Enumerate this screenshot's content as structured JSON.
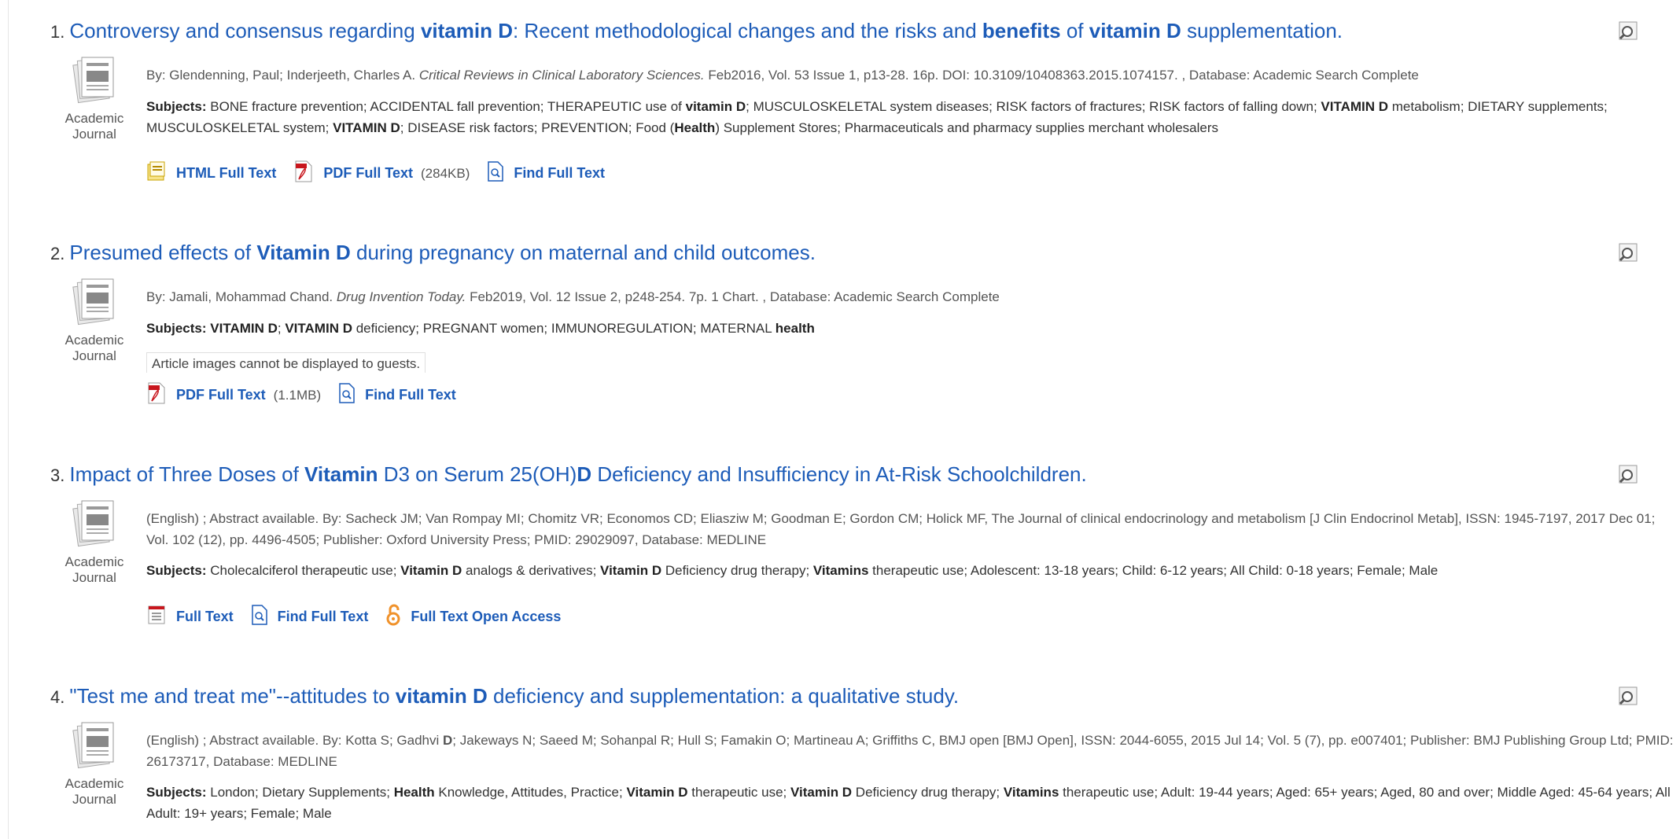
{
  "icons": {
    "document": "academic-journal-icon",
    "preview": "magnifier-preview-icon",
    "html": "html-document-icon",
    "pdf": "pdf-icon",
    "find": "find-document-icon",
    "open_access": "open-lock-icon",
    "fulltext": "fulltext-document-icon"
  },
  "colors": {
    "link": "#1d5cb8",
    "open_access": "#f0922b"
  },
  "results": [
    {
      "number": "1.",
      "title": [
        {
          "t": "Controversy and consensus regarding "
        },
        {
          "t": "vitamin D",
          "b": true
        },
        {
          "t": ": Recent methodological changes and the risks and "
        },
        {
          "t": "benefits",
          "b": true
        },
        {
          "t": " of "
        },
        {
          "t": "vitamin D",
          "b": true
        },
        {
          "t": " supplementation."
        }
      ],
      "type_line1": "Academic",
      "type_line2": "Journal",
      "meta": [
        {
          "t": "By: Glendenning, Paul; Inderjeeth, Charles A. "
        },
        {
          "t": "Critical Reviews in Clinical Laboratory Sciences.",
          "i": true
        },
        {
          "t": " Feb2016, Vol. 53 Issue 1, p13-28. 16p. DOI: 10.3109/10408363.2015.1074157. , Database: Academic Search Complete"
        }
      ],
      "subjects_label": "Subjects:",
      "subjects": [
        {
          "t": " BONE fracture prevention; ACCIDENTAL fall prevention; THERAPEUTIC use of "
        },
        {
          "t": "vitamin D",
          "b": true
        },
        {
          "t": "; MUSCULOSKELETAL system diseases; RISK factors of fractures; RISK factors of falling down; "
        },
        {
          "t": "VITAMIN D",
          "b": true
        },
        {
          "t": " metabolism; DIETARY supplements; MUSCULOSKELETAL system; "
        },
        {
          "t": "VITAMIN D",
          "b": true
        },
        {
          "t": "; DISEASE risk factors; PREVENTION; Food ("
        },
        {
          "t": "Health",
          "b": true
        },
        {
          "t": ") Supplement Stores; Pharmaceuticals and pharmacy supplies merchant wholesalers"
        }
      ],
      "links": [
        {
          "icon": "html",
          "label": "HTML Full Text"
        },
        {
          "icon": "pdf",
          "label": "PDF Full Text",
          "size": "(284KB)"
        },
        {
          "icon": "find",
          "label": "Find Full Text"
        }
      ]
    },
    {
      "number": "2.",
      "title": [
        {
          "t": "Presumed effects of "
        },
        {
          "t": "Vitamin D",
          "b": true
        },
        {
          "t": " during pregnancy on maternal and child outcomes."
        }
      ],
      "type_line1": "Academic",
      "type_line2": "Journal",
      "meta": [
        {
          "t": "By: Jamali, Mohammad Chand. "
        },
        {
          "t": "Drug Invention Today.",
          "i": true
        },
        {
          "t": " Feb2019, Vol. 12 Issue 2, p248-254. 7p. 1 Chart. , Database: Academic Search Complete"
        }
      ],
      "subjects_label": "Subjects:",
      "subjects": [
        {
          "t": " "
        },
        {
          "t": "VITAMIN D",
          "b": true
        },
        {
          "t": "; "
        },
        {
          "t": "VITAMIN D",
          "b": true
        },
        {
          "t": " deficiency; PREGNANT women; IMMUNOREGULATION; MATERNAL "
        },
        {
          "t": "health",
          "b": true
        }
      ],
      "guest_note": "Article images cannot be displayed to guests.",
      "links": [
        {
          "icon": "pdf",
          "label": "PDF Full Text",
          "size": "(1.1MB)"
        },
        {
          "icon": "find",
          "label": "Find Full Text"
        }
      ]
    },
    {
      "number": "3.",
      "title": [
        {
          "t": "Impact of Three Doses of "
        },
        {
          "t": "Vitamin",
          "b": true
        },
        {
          "t": " D3 on Serum 25(OH)"
        },
        {
          "t": "D",
          "b": true
        },
        {
          "t": " Deficiency and Insufficiency in At-Risk Schoolchildren."
        }
      ],
      "type_line1": "Academic",
      "type_line2": "Journal",
      "meta": [
        {
          "t": "(English) ; Abstract available. By: Sacheck JM; Van Rompay MI; Chomitz VR; Economos CD; Eliasziw M; Goodman E; Gordon CM; Holick MF, The Journal of clinical endocrinology and metabolism [J Clin Endocrinol Metab], ISSN: 1945-7197, 2017 Dec 01; Vol. 102 (12), pp. 4496-4505; Publisher: Oxford University Press; PMID: 29029097, Database: MEDLINE"
        }
      ],
      "subjects_label": "Subjects:",
      "subjects": [
        {
          "t": " Cholecalciferol therapeutic use; "
        },
        {
          "t": "Vitamin D",
          "b": true
        },
        {
          "t": " analogs & derivatives; "
        },
        {
          "t": "Vitamin D",
          "b": true
        },
        {
          "t": " Deficiency drug therapy; "
        },
        {
          "t": "Vitamins",
          "b": true
        },
        {
          "t": " therapeutic use; Adolescent: 13-18 years; Child: 6-12 years; All Child: 0-18 years; Female; Male"
        }
      ],
      "links": [
        {
          "icon": "fulltext",
          "label": "Full Text"
        },
        {
          "icon": "find",
          "label": "Find Full Text"
        },
        {
          "icon": "open_access",
          "label": "Full Text Open Access"
        }
      ]
    },
    {
      "number": "4.",
      "title": [
        {
          "t": "\"Test me and treat me\"--attitudes to "
        },
        {
          "t": "vitamin D",
          "b": true
        },
        {
          "t": " deficiency and supplementation: a qualitative study."
        }
      ],
      "type_line1": "Academic",
      "type_line2": "Journal",
      "meta": [
        {
          "t": "(English) ; Abstract available. By: Kotta S; Gadhvi "
        },
        {
          "t": "D",
          "b": true
        },
        {
          "t": "; Jakeways N; Saeed M; Sohanpal R; Hull S; Famakin O; Martineau A; Griffiths C, BMJ open [BMJ Open], ISSN: 2044-6055, 2015 Jul 14; Vol. 5 (7), pp. e007401; Publisher: BMJ Publishing Group Ltd; PMID: 26173717, Database: MEDLINE"
        }
      ],
      "subjects_label": "Subjects:",
      "subjects": [
        {
          "t": " London; Dietary Supplements; "
        },
        {
          "t": "Health",
          "b": true
        },
        {
          "t": " Knowledge, Attitudes, Practice; "
        },
        {
          "t": "Vitamin D",
          "b": true
        },
        {
          "t": " therapeutic use; "
        },
        {
          "t": "Vitamin D",
          "b": true
        },
        {
          "t": " Deficiency drug therapy; "
        },
        {
          "t": "Vitamins",
          "b": true
        },
        {
          "t": " therapeutic use; Adult: 19-44 years; Aged: 65+ years; Aged, 80 and over; Middle Aged: 45-64 years; All Adult: 19+ years; Female; Male"
        }
      ],
      "links": []
    }
  ]
}
